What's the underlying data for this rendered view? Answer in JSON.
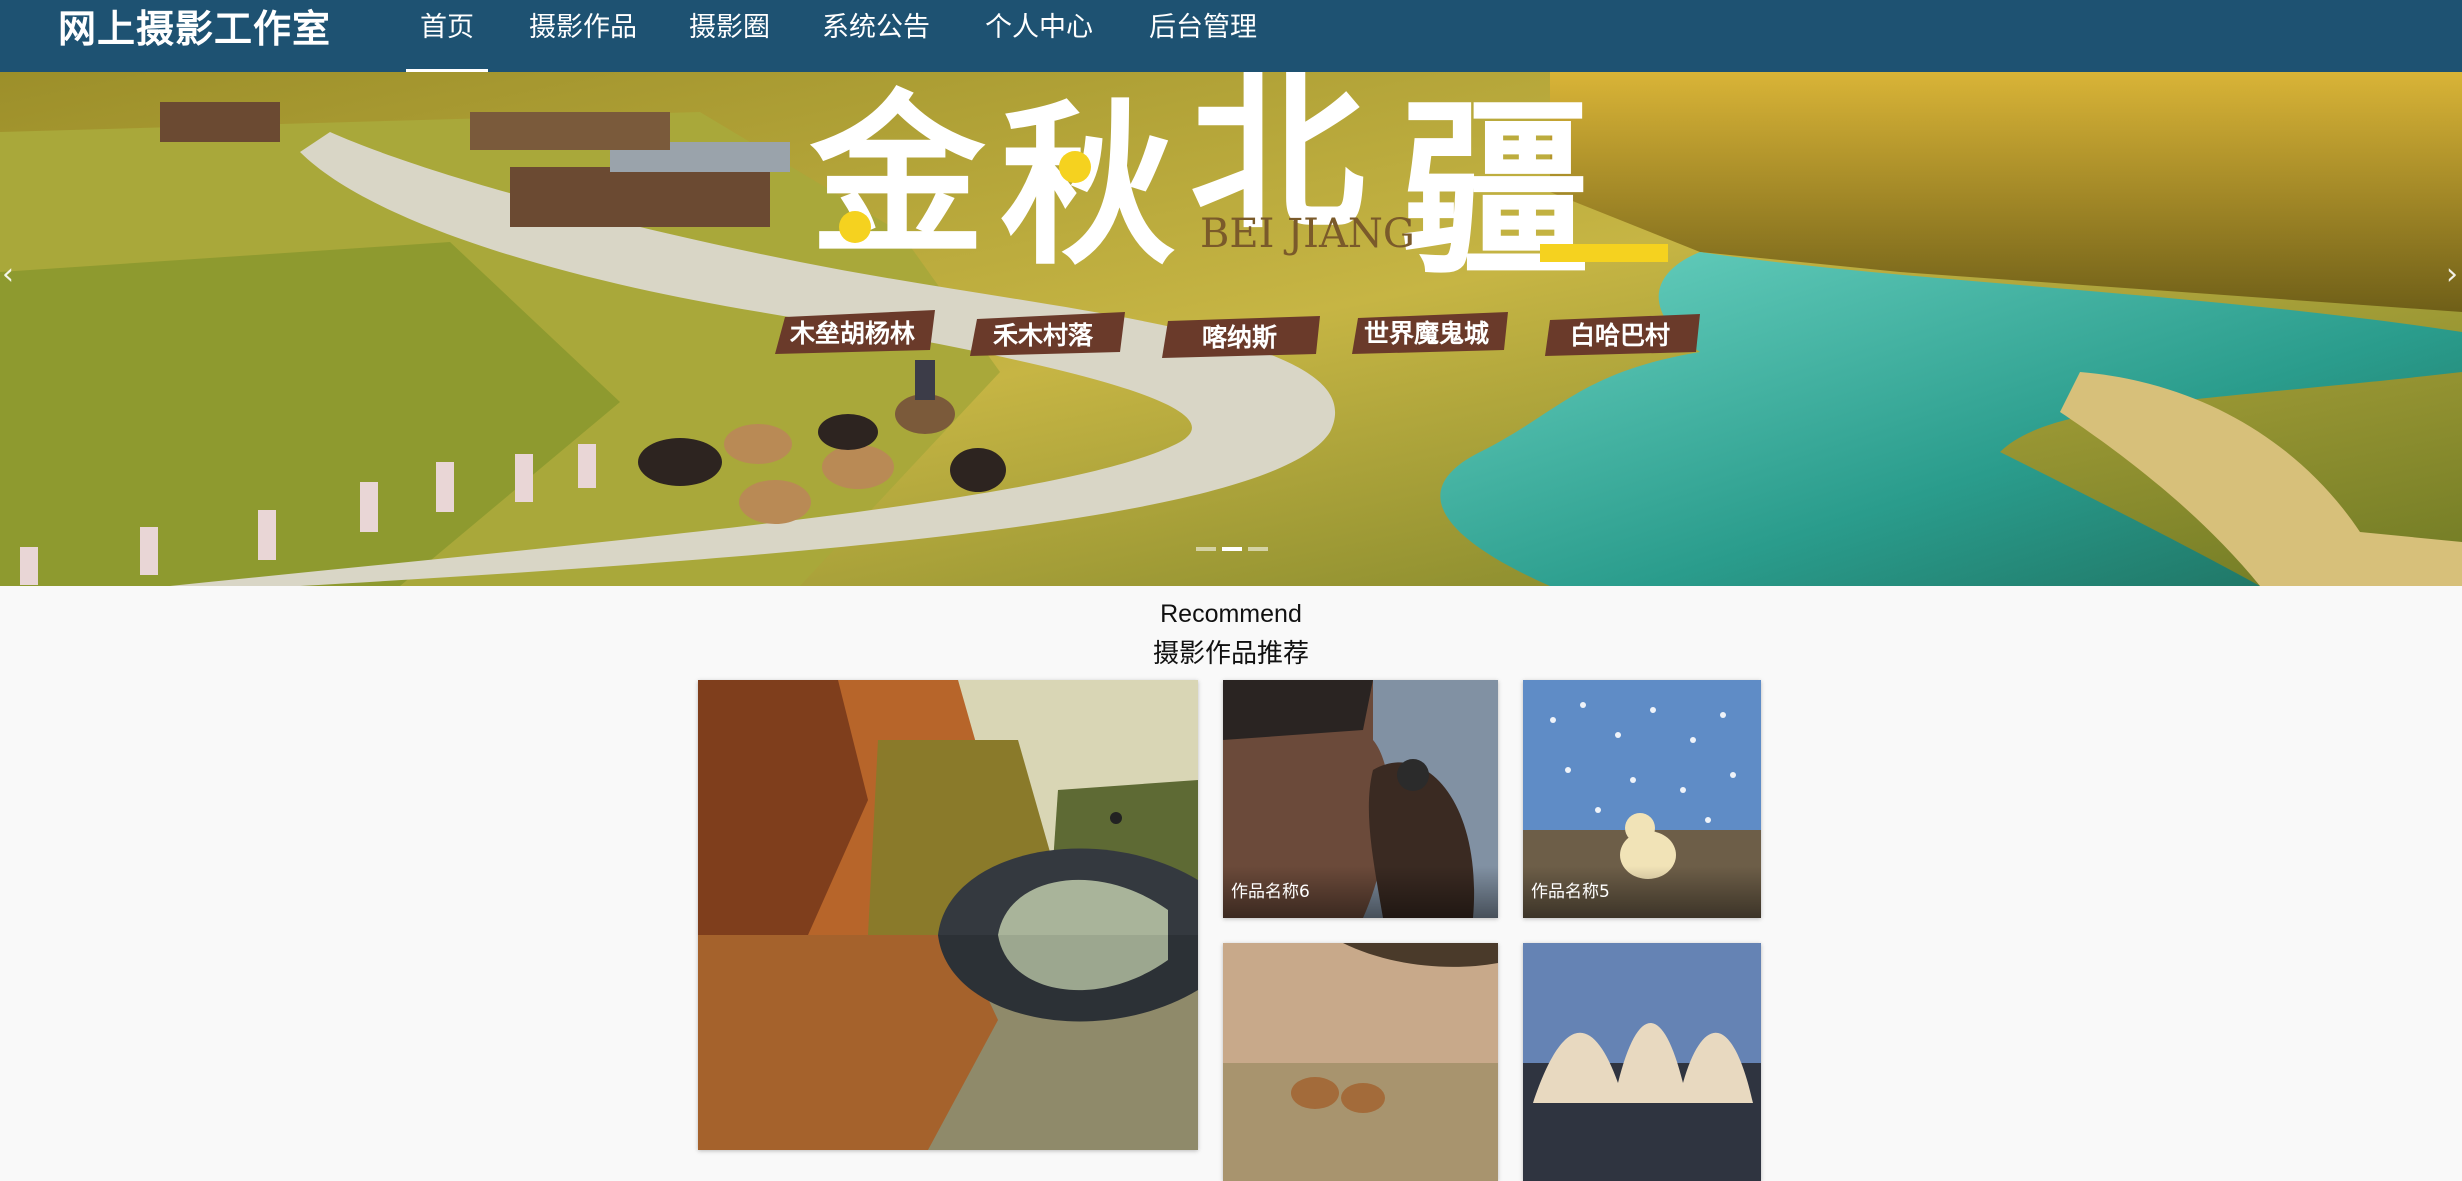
{
  "navbar": {
    "brand": "网上摄影工作室",
    "items": [
      "首页",
      "摄影作品",
      "摄影圈",
      "系统公告",
      "个人中心",
      "后台管理"
    ],
    "active_index": 0,
    "background": "#1e5272"
  },
  "banner": {
    "title_chars": [
      "金",
      "秋",
      "北",
      "疆"
    ],
    "subtitle": "BEI JIANG",
    "tags": [
      "木垒胡杨林",
      "禾木村落",
      "喀纳斯",
      "世界魔鬼城",
      "白哈巴村"
    ],
    "prev_icon": "chevron-left-icon",
    "next_icon": "chevron-right-icon",
    "slide_count": 3,
    "active_slide": 1
  },
  "recommend": {
    "title_en": "Recommend",
    "title_cn": "摄影作品推荐",
    "works": [
      {
        "caption": ""
      },
      {
        "caption": "作品名称6"
      },
      {
        "caption": "作品名称5"
      },
      {
        "caption": ""
      },
      {
        "caption": ""
      }
    ]
  }
}
